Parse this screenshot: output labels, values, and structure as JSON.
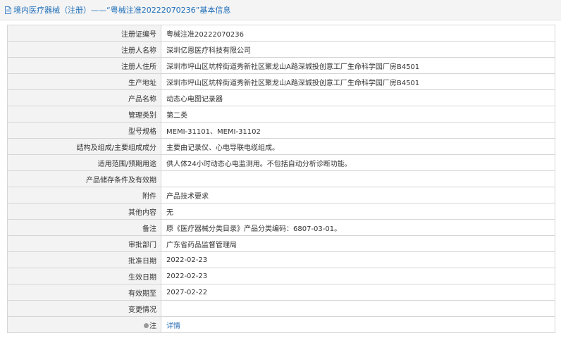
{
  "header": {
    "title": "境内医疗器械（注册）——“粤械注准20222070236”基本信息"
  },
  "rows": [
    {
      "label": "注册证编号",
      "value": "粤械注准20222070236"
    },
    {
      "label": "注册人名称",
      "value": "深圳亿恩医疗科技有限公司"
    },
    {
      "label": "注册人住所",
      "value": "深圳市坪山区坑梓街道秀新社区聚龙山A路深城投创意工厂生命科学园厂房B4501"
    },
    {
      "label": "生产地址",
      "value": "深圳市坪山区坑梓街道秀新社区聚龙山A路深城投创意工厂生命科学园厂房B4501"
    },
    {
      "label": "产品名称",
      "value": "动态心电图记录器"
    },
    {
      "label": "管理类别",
      "value": "第二类"
    },
    {
      "label": "型号规格",
      "value": "MEMI-31101、MEMI-31102"
    },
    {
      "label": "结构及组成/主要组成成分",
      "value": "主要由记录仪、心电导联电缆组成。"
    },
    {
      "label": "适用范围/预期用途",
      "value": "供人体24小时动态心电监测用。不包括自动分析诊断功能。"
    },
    {
      "label": "产品储存条件及有效期",
      "value": ""
    },
    {
      "label": "附件",
      "value": "产品技术要求"
    },
    {
      "label": "其他内容",
      "value": "无"
    },
    {
      "label": "备注",
      "value": "原《医疗器械分类目录》产品分类编码：6807-03-01。"
    },
    {
      "label": "审批部门",
      "value": "广东省药品监督管理局"
    },
    {
      "label": "批准日期",
      "value": "2022-02-23"
    },
    {
      "label": "生效日期",
      "value": "2022-02-23"
    },
    {
      "label": "有效期至",
      "value": "2027-02-22"
    },
    {
      "label": "变更情况",
      "value": ""
    }
  ],
  "note_row": {
    "label": "注",
    "value": "详情"
  }
}
